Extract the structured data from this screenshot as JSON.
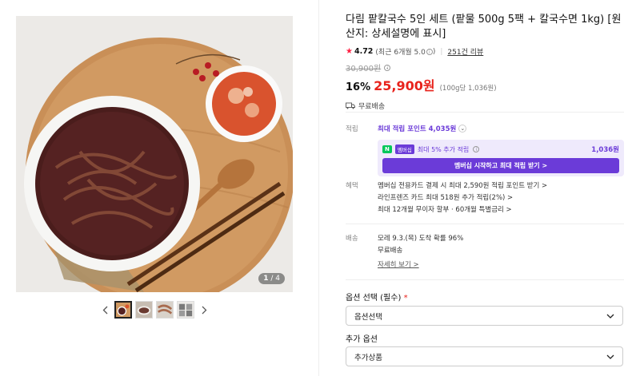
{
  "product": {
    "title": "다림 팥칼국수 5인 세트 (팥물 500g 5팩 + 칼국수면 1kg) [원산지: 상세설명에 표시]",
    "rating": "4.72",
    "rating_note": "(최근 6개월 5.0",
    "review_count": "251건 리뷰",
    "original_price": "30,900원",
    "discount": "16%",
    "price": "25,900원",
    "unit_price": "(100g당 1,036원)",
    "shipping": "무료배송"
  },
  "gallery": {
    "page_current": "1",
    "page_total": "/ 4"
  },
  "points": {
    "label": "적립",
    "max_points": "최대 적립 포인트 4,035원",
    "npay_badge": "N",
    "member_badge": "멤버십",
    "member_extra": "최대 5% 추가 적립",
    "member_amount": "1,036원",
    "member_button": "멤버십 시작하고 최대 적립 받기 >"
  },
  "benefits": {
    "label": "혜택",
    "lines": [
      "멤버십 전용카드 결제 시 최대 2,590원 적립 포인트 받기 >",
      "라인프렌즈 카드 최대 518원 추가 적립(2%) >",
      "최대 12개월 무이자 할부 · 60개월 특별금리 >"
    ]
  },
  "delivery": {
    "label": "배송",
    "arrival": "모레 9.3.(목) 도착 확률 96%",
    "fee": "무료배송",
    "detail_link": "자세히 보기 >"
  },
  "options": {
    "required_label": "옵션 선택 (필수)",
    "required_mark": "*",
    "required_value": "옵션선택",
    "extra_label": "추가 옵션",
    "extra_value": "추가상품"
  },
  "colors": {
    "price_red": "#e8231c",
    "point_purple": "#6b3bd8",
    "npay_green": "#03c75a",
    "star": "#ff2244"
  },
  "icons": [
    "star-icon",
    "info-icon",
    "truck-icon",
    "chevron-down-icon",
    "chevron-left-icon",
    "chevron-right-icon"
  ]
}
